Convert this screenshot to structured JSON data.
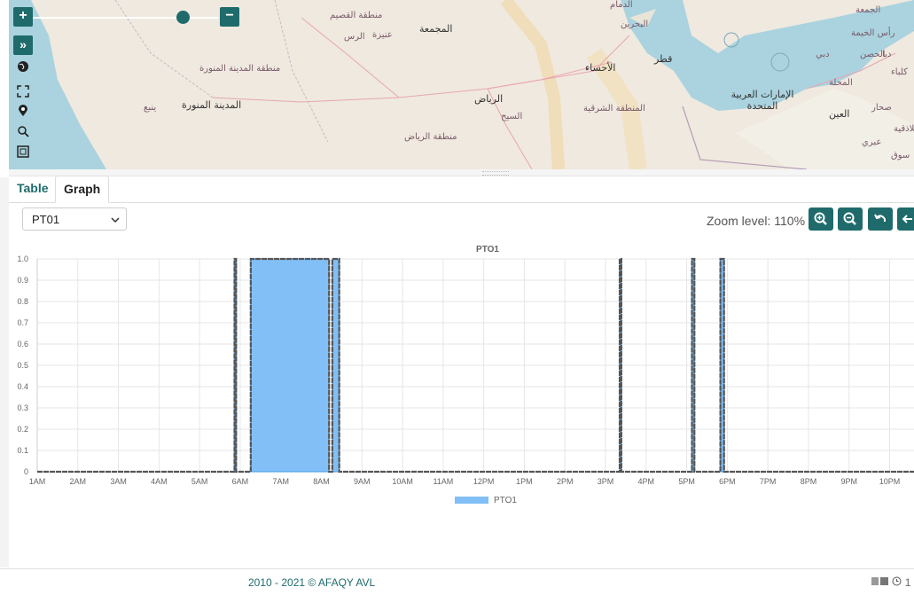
{
  "map": {
    "zoom_in": "+",
    "zoom_out": "−",
    "zoom_slider_level": 0.8,
    "expand_icon": "»",
    "labels": [
      {
        "text": "منطقة القصيم",
        "big": false
      },
      {
        "text": "الرس",
        "big": false
      },
      {
        "text": "عنيزة",
        "big": false
      },
      {
        "text": "المجمعة",
        "big": true
      },
      {
        "text": "الدمام",
        "big": false
      },
      {
        "text": "البحرين",
        "big": false
      },
      {
        "text": "قطر",
        "big": true
      },
      {
        "text": "الأحساء",
        "big": true
      },
      {
        "text": "الرياض",
        "big": true
      },
      {
        "text": "منطقة المدينة المنورة",
        "big": false
      },
      {
        "text": "المدينة المنورة",
        "big": true
      },
      {
        "text": "ينبع",
        "big": false
      },
      {
        "text": "السيح",
        "big": false
      },
      {
        "text": "المنطقة الشرقية",
        "big": false
      },
      {
        "text": "منطقة الرياض",
        "big": false
      },
      {
        "text": "الإمارات العربية المتحدة",
        "big": true
      },
      {
        "text": "رأس الخيمة",
        "big": false
      },
      {
        "text": "دبي",
        "big": false
      },
      {
        "text": "العين",
        "big": true
      },
      {
        "text": "صحار",
        "big": false
      },
      {
        "text": "عبري",
        "big": false
      },
      {
        "text": "سوق",
        "big": false
      },
      {
        "text": "الجمعة",
        "big": false
      },
      {
        "text": "كلباء",
        "big": false
      },
      {
        "text": "الحصن",
        "big": false
      },
      {
        "text": "دبا",
        "big": false
      },
      {
        "text": "المحلة",
        "big": false
      },
      {
        "text": "اللاذقية",
        "big": false
      }
    ]
  },
  "tabs": {
    "table": "Table",
    "graph": "Graph"
  },
  "select": {
    "value": "PT01"
  },
  "zoom": {
    "label": "Zoom level: 110%"
  },
  "colors": {
    "accent": "#1f6b6b",
    "series_fill": "#82bff6",
    "series_line": "#4a9de8"
  },
  "chart_data": {
    "type": "area",
    "title": "PTO1",
    "legend": [
      "PTO1"
    ],
    "legend_position": "bottom",
    "grid": true,
    "ylim": [
      0,
      1
    ],
    "y_ticks": [
      "0",
      "0.1",
      "0.2",
      "0.3",
      "0.4",
      "0.5",
      "0.6",
      "0.7",
      "0.8",
      "0.9",
      "1.0"
    ],
    "x_ticks": [
      "1AM",
      "2AM",
      "3AM",
      "4AM",
      "5AM",
      "6AM",
      "7AM",
      "8AM",
      "9AM",
      "10AM",
      "11AM",
      "12PM",
      "1PM",
      "2PM",
      "3PM",
      "4PM",
      "5PM",
      "6PM",
      "7PM",
      "8PM",
      "9PM",
      "10PM"
    ],
    "x_unit": "hour_of_day",
    "xlim": [
      1,
      22.6
    ],
    "series": [
      {
        "name": "PTO1",
        "on_intervals": [
          [
            5.86,
            5.9
          ],
          [
            6.26,
            8.19
          ],
          [
            8.27,
            8.44
          ],
          [
            15.35,
            15.39
          ],
          [
            17.13,
            17.19
          ],
          [
            17.83,
            17.92
          ]
        ]
      }
    ]
  },
  "footer": {
    "text": "2010 - 2021 © AFAQY AVL",
    "right": "1"
  }
}
